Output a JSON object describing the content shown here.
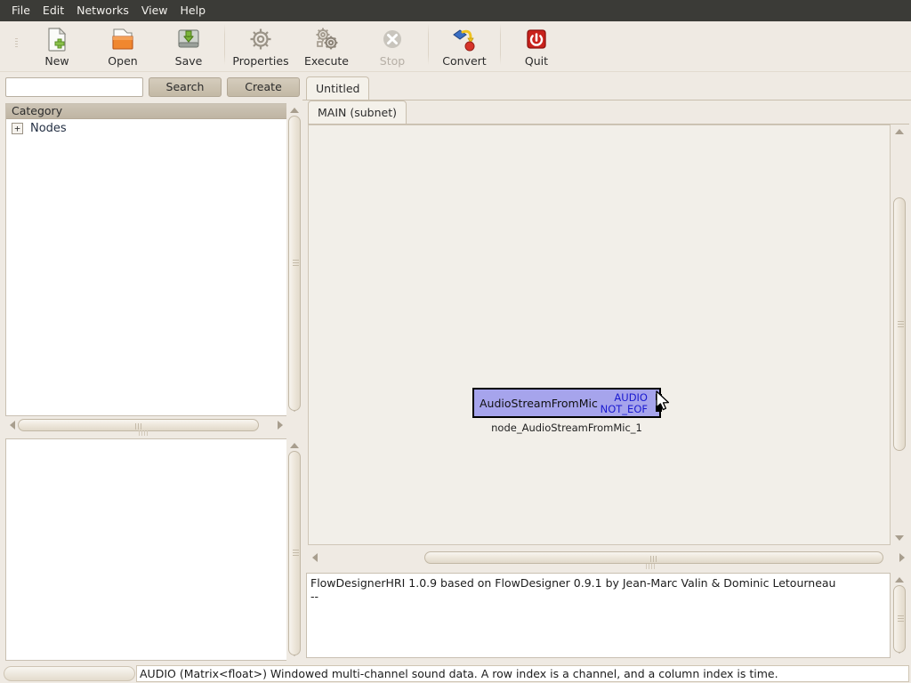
{
  "menu": {
    "items": [
      {
        "label": "File",
        "name": "menu-file"
      },
      {
        "label": "Edit",
        "name": "menu-edit"
      },
      {
        "label": "Networks",
        "name": "menu-networks"
      },
      {
        "label": "View",
        "name": "menu-view"
      },
      {
        "label": "Help",
        "name": "menu-help"
      }
    ]
  },
  "toolbar": {
    "buttons": [
      {
        "label": "New",
        "icon": "new-document-icon",
        "enabled": true
      },
      {
        "label": "Open",
        "icon": "open-folder-icon",
        "enabled": true
      },
      {
        "label": "Save",
        "icon": "save-disk-icon",
        "enabled": true
      },
      {
        "label": "Properties",
        "icon": "gear-icon",
        "enabled": true
      },
      {
        "label": "Execute",
        "icon": "gears-run-icon",
        "enabled": true
      },
      {
        "label": "Stop",
        "icon": "stop-x-circle-icon",
        "enabled": false
      },
      {
        "label": "Convert",
        "icon": "convert-icon",
        "enabled": true
      },
      {
        "label": "Quit",
        "icon": "power-quit-icon",
        "enabled": true
      }
    ]
  },
  "search": {
    "value": "",
    "placeholder": "",
    "search_label": "Search",
    "create_label": "Create"
  },
  "category_panel": {
    "header": "Category",
    "tree": [
      {
        "expander": "+",
        "label": "Nodes"
      }
    ]
  },
  "tabs": {
    "document": [
      {
        "label": "Untitled",
        "active": true
      }
    ],
    "subnet": [
      {
        "label": "MAIN (subnet)",
        "active": true
      }
    ]
  },
  "canvas": {
    "node": {
      "title": "AudioStreamFromMic",
      "caption": "node_AudioStreamFromMic_1",
      "outputs": [
        "AUDIO",
        "NOT_EOF"
      ],
      "fill_color": "#a6a4ec",
      "border_color": "#000000",
      "port_label_color": "#1a1ad0"
    }
  },
  "log": {
    "lines": [
      "FlowDesignerHRI 1.0.9 based on FlowDesigner 0.9.1 by Jean-Marc Valin & Dominic Letourneau",
      "--"
    ]
  },
  "statusbar": {
    "message": "AUDIO (Matrix<float>) Windowed multi-channel sound data. A row index is a channel, and a column index is time."
  },
  "theme": {
    "menubar_bg": "#3b3b37",
    "chrome_bg": "#efeae3",
    "panel_bg": "#ffffff",
    "canvas_bg": "#f2efe9",
    "accent_button": "#c3b9a5"
  }
}
